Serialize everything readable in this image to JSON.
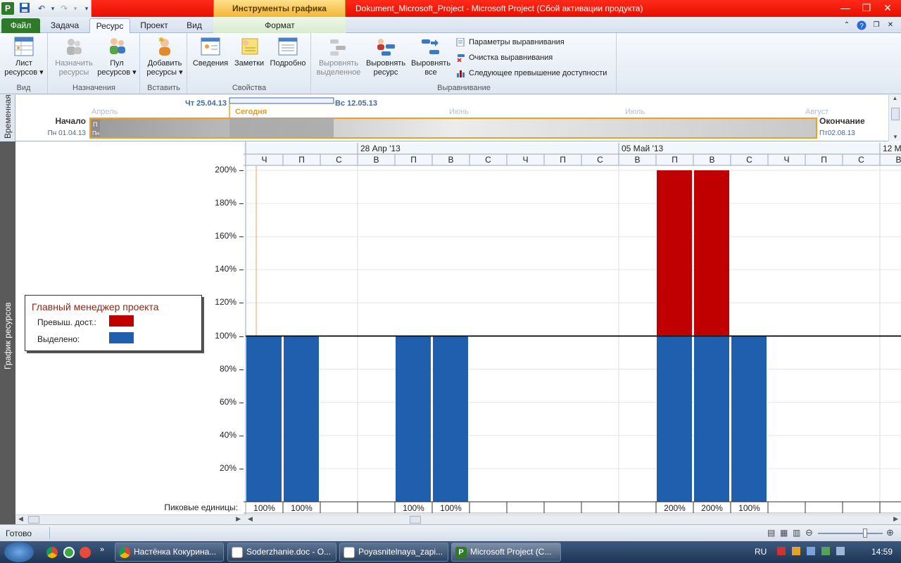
{
  "window": {
    "context_tab": "Инструменты графика ресурсов",
    "title": "Dokument_Microsoft_Project  -  Microsoft Project (Сбой активации продукта)"
  },
  "tabs": [
    {
      "label": "Файл"
    },
    {
      "label": "Задача"
    },
    {
      "label": "Ресурс"
    },
    {
      "label": "Проект"
    },
    {
      "label": "Вид"
    },
    {
      "label": "Формат"
    }
  ],
  "ribbon": {
    "groups": {
      "view": "Вид",
      "assignments": "Назначения",
      "insert": "Вставить",
      "properties": "Свойства",
      "leveling": "Выравнивание"
    },
    "buttons": {
      "resource_sheet": [
        "Лист",
        "ресурсов ▾"
      ],
      "assign_resources": [
        "Назначить",
        "ресурсы"
      ],
      "resource_pool": [
        "Пул",
        "ресурсов ▾"
      ],
      "add_resources": [
        "Добавить",
        "ресурсы ▾"
      ],
      "information": [
        "Сведения"
      ],
      "notes": [
        "Заметки"
      ],
      "details": [
        "Подробно"
      ],
      "level_selection": [
        "Выровнять",
        "выделенное"
      ],
      "level_resource": [
        "Выровнять",
        "ресурс"
      ],
      "level_all": [
        "Выровнять",
        "все"
      ]
    },
    "leveling_small": {
      "options": "Параметры выравнивания",
      "clear": "Очистка выравнивания",
      "next_overallocation": "Следующее превышение доступности"
    }
  },
  "timeline": {
    "side_label": "Временная",
    "start_label": "Начало",
    "start_date": "Пн 01.04.13",
    "end_label": "Окончание",
    "end_date": "Пт02.08.13",
    "view_start": "Чт 25.04.13",
    "view_end": "Вс 12.05.13",
    "today": "Сегодня",
    "months": [
      "Апрель",
      "Июнь",
      "Июль",
      "Август"
    ],
    "mini_task": [
      "П",
      "Пн"
    ]
  },
  "graph": {
    "side_label": "График ресурсов",
    "legend": {
      "title": "Главный менеджер проекта",
      "overallocated": "Превыш. дост.:",
      "allocated": "Выделено:",
      "overallocated_color": "#c00000",
      "allocated_color": "#1f5fad"
    },
    "peak_label": "Пиковые единицы:"
  },
  "chart_data": {
    "type": "bar",
    "week_labels": [
      "28 Апр '13",
      "05 Май '13",
      "12 М"
    ],
    "categories": [
      "Ч",
      "П",
      "С",
      "В",
      "П",
      "В",
      "С",
      "Ч",
      "П",
      "С",
      "В",
      "П",
      "В",
      "С",
      "Ч",
      "П",
      "С",
      "В"
    ],
    "yticks": [
      "20%",
      "40%",
      "60%",
      "80%",
      "100%",
      "120%",
      "140%",
      "160%",
      "180%",
      "200%"
    ],
    "ylim": [
      0,
      200
    ],
    "series": [
      {
        "name": "Выделено",
        "color": "#1f5fad",
        "values": [
          100,
          100,
          0,
          0,
          100,
          100,
          0,
          0,
          0,
          0,
          0,
          100,
          100,
          100,
          0,
          0,
          0,
          0
        ]
      },
      {
        "name": "Превыш. дост.",
        "color": "#c00000",
        "values": [
          0,
          0,
          0,
          0,
          0,
          0,
          0,
          0,
          0,
          0,
          0,
          100,
          100,
          0,
          0,
          0,
          0,
          0
        ]
      }
    ],
    "peak_units": [
      "100%",
      "100%",
      "",
      "",
      "100%",
      "100%",
      "",
      "",
      "",
      "",
      "",
      "200%",
      "200%",
      "100%",
      "",
      "",
      "",
      ""
    ]
  },
  "statusbar": {
    "status": "Готово"
  },
  "taskbar": {
    "items": [
      {
        "label": "Настёнка Кокурина..."
      },
      {
        "label": "Soderzhanie.doc - O..."
      },
      {
        "label": "Poyasnitelnaya_zapi..."
      },
      {
        "label": "Microsoft Project (C..."
      }
    ],
    "language": "RU",
    "time": "14:59"
  }
}
